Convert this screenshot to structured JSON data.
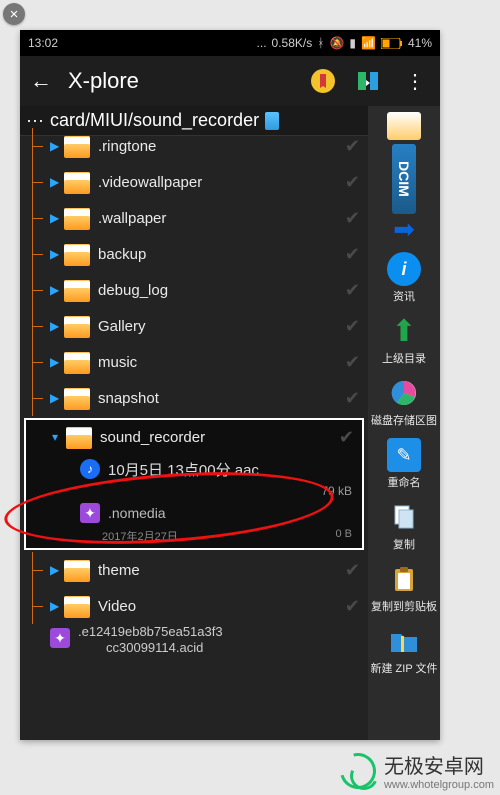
{
  "status_bar": {
    "time": "13:02",
    "net_speed": "0.58K/s",
    "battery": "41%"
  },
  "app": {
    "title": "X-plore"
  },
  "breadcrumb": {
    "prefix": "···",
    "path": "card/MIUI/sound_recorder"
  },
  "rail": {
    "tab_label": "DCIM",
    "items": [
      {
        "label": "资讯",
        "color": "#0a8ef0"
      },
      {
        "label": "上级目录",
        "color": "#1fa64a"
      },
      {
        "label": "磁盘存储区图",
        "color": "#e84aa0"
      },
      {
        "label": "重命名",
        "color": "#1d8fe6"
      },
      {
        "label": "复制",
        "color": "#8a8a8a"
      },
      {
        "label": "复制到剪贴板",
        "color": "#d8a43a"
      },
      {
        "label": "新建 ZIP 文件",
        "color": "#2f8fd8"
      }
    ]
  },
  "folders": [
    {
      "name": ".ringtone"
    },
    {
      "name": ".videowallpaper"
    },
    {
      "name": ".wallpaper"
    },
    {
      "name": "backup"
    },
    {
      "name": "debug_log"
    },
    {
      "name": "Gallery"
    },
    {
      "name": "music"
    },
    {
      "name": "snapshot"
    },
    {
      "name": "sound_recorder",
      "selected": true,
      "children": [
        {
          "type": "audio",
          "name": "10月5日 13点00分.aac",
          "size": "79 kB"
        },
        {
          "type": "nomedia",
          "name": ".nomedia",
          "date": "2017年2月27日",
          "size": "0 B"
        }
      ]
    },
    {
      "name": "theme"
    },
    {
      "name": "Video"
    }
  ],
  "bottom_file": {
    "line1": ".e12419eb8b75ea51a3f3",
    "line2": "cc30099114.acid"
  },
  "watermark": {
    "title": "无极安卓网",
    "sub": "www.whotelgroup.com"
  }
}
